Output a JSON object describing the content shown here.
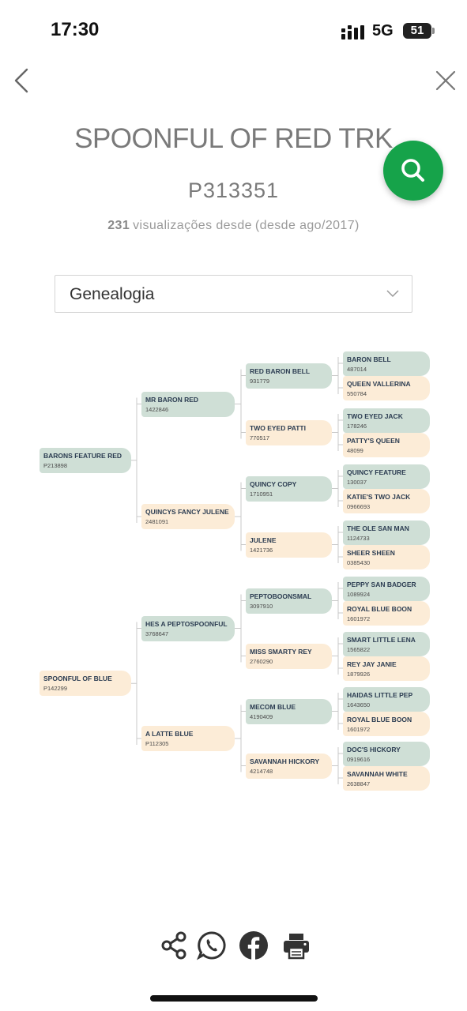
{
  "status_bar": {
    "time": "17:30",
    "network": "5G",
    "battery": "51"
  },
  "header": {
    "horse_name": "SPOONFUL OF RED TRK",
    "registration": "P313351"
  },
  "views": {
    "count": "231",
    "label": "visualizações desde",
    "since": "(desde ago/2017)"
  },
  "section_select": {
    "value": "Genealogia"
  },
  "pedigree": {
    "gen1": [
      {
        "name": "BARONS FEATURE RED",
        "reg": "P213898",
        "color": "green"
      },
      {
        "name": "SPOONFUL OF BLUE",
        "reg": "P142299",
        "color": "cream"
      }
    ],
    "gen2": [
      {
        "name": "MR BARON RED",
        "reg": "1422846",
        "color": "green"
      },
      {
        "name": "QUINCYS FANCY JULENE",
        "reg": "2481091",
        "color": "cream"
      },
      {
        "name": "HES A PEPTOSPOONFUL",
        "reg": "3768647",
        "color": "green"
      },
      {
        "name": "A LATTE BLUE",
        "reg": "P112305",
        "color": "cream"
      }
    ],
    "gen3": [
      {
        "name": "RED BARON BELL",
        "reg": "931779",
        "color": "green"
      },
      {
        "name": "TWO EYED PATTI",
        "reg": "770517",
        "color": "cream"
      },
      {
        "name": "QUINCY COPY",
        "reg": "1710951",
        "color": "green"
      },
      {
        "name": "JULENE",
        "reg": "1421736",
        "color": "cream"
      },
      {
        "name": "PEPTOBOONSMAL",
        "reg": "3097910",
        "color": "green"
      },
      {
        "name": "MISS SMARTY REY",
        "reg": "2760290",
        "color": "cream"
      },
      {
        "name": "MECOM BLUE",
        "reg": "4190409",
        "color": "green"
      },
      {
        "name": "SAVANNAH HICKORY",
        "reg": "4214748",
        "color": "cream"
      }
    ],
    "gen4": [
      {
        "name": "BARON BELL",
        "reg": "487014",
        "color": "green"
      },
      {
        "name": "QUEEN VALLERINA",
        "reg": "550784",
        "color": "cream"
      },
      {
        "name": "TWO EYED JACK",
        "reg": "178246",
        "color": "green"
      },
      {
        "name": "PATTY'S QUEEN",
        "reg": "48099",
        "color": "cream"
      },
      {
        "name": "QUINCY FEATURE",
        "reg": "130037",
        "color": "green"
      },
      {
        "name": "KATIE'S TWO JACK",
        "reg": "0966693",
        "color": "cream"
      },
      {
        "name": "THE OLE SAN MAN",
        "reg": "1124733",
        "color": "green"
      },
      {
        "name": "SHEER SHEEN",
        "reg": "0385430",
        "color": "cream"
      },
      {
        "name": "PEPPY SAN BADGER",
        "reg": "1089924",
        "color": "green"
      },
      {
        "name": "ROYAL BLUE BOON",
        "reg": "1601972",
        "color": "cream"
      },
      {
        "name": "SMART LITTLE LENA",
        "reg": "1565822",
        "color": "green"
      },
      {
        "name": "REY JAY JANIE",
        "reg": "1879926",
        "color": "cream"
      },
      {
        "name": "HAIDAS LITTLE PEP",
        "reg": "1643650",
        "color": "green"
      },
      {
        "name": "ROYAL BLUE BOON",
        "reg": "1601972",
        "color": "cream"
      },
      {
        "name": "DOC'S HICKORY",
        "reg": "0919616",
        "color": "green"
      },
      {
        "name": "SAVANNAH WHITE",
        "reg": "2638847",
        "color": "cream"
      }
    ]
  },
  "share": [
    {
      "icon": "share-icon"
    },
    {
      "icon": "whatsapp-icon"
    },
    {
      "icon": "facebook-icon"
    },
    {
      "icon": "print-icon"
    }
  ],
  "colors": {
    "accent": "#16a34a",
    "node_green": "#cfdfd6",
    "node_cream": "#fcecd7",
    "text": "#2c3d52"
  }
}
